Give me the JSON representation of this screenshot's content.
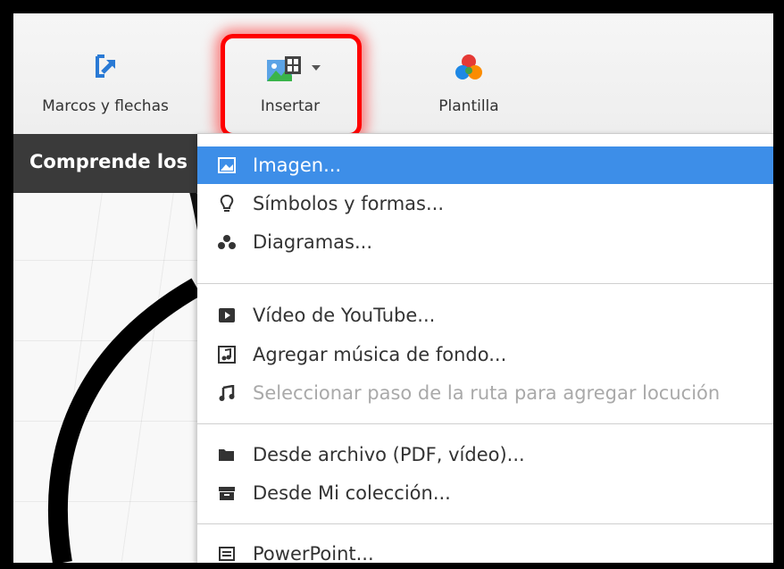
{
  "toolbar": {
    "frames_label": "Marcos y flechas",
    "insert_label": "Insertar",
    "template_label": "Plantilla"
  },
  "canvas": {
    "title": "Comprende los"
  },
  "menu": {
    "items": [
      {
        "label": "Imagen...",
        "icon": "image-icon",
        "state": "selected"
      },
      {
        "label": "Símbolos y formas...",
        "icon": "lightbulb-icon",
        "state": "normal"
      },
      {
        "label": "Diagramas...",
        "icon": "diagram-icon",
        "state": "normal"
      },
      {
        "label": "Vídeo de YouTube...",
        "icon": "youtube-icon",
        "state": "normal"
      },
      {
        "label": "Agregar música de fondo...",
        "icon": "music-file-icon",
        "state": "normal"
      },
      {
        "label": "Seleccionar paso de la ruta para agregar locución",
        "icon": "music-note-icon",
        "state": "disabled"
      },
      {
        "label": "Desde archivo (PDF, vídeo)...",
        "icon": "folder-icon",
        "state": "normal"
      },
      {
        "label": "Desde Mi colección...",
        "icon": "collection-box-icon",
        "state": "normal"
      },
      {
        "label": "PowerPoint...",
        "icon": "powerpoint-icon",
        "state": "normal"
      }
    ]
  },
  "colors": {
    "highlight": "#ff0000",
    "selected": "#3d8ee8",
    "frame_icon": "#2a7ad5"
  }
}
